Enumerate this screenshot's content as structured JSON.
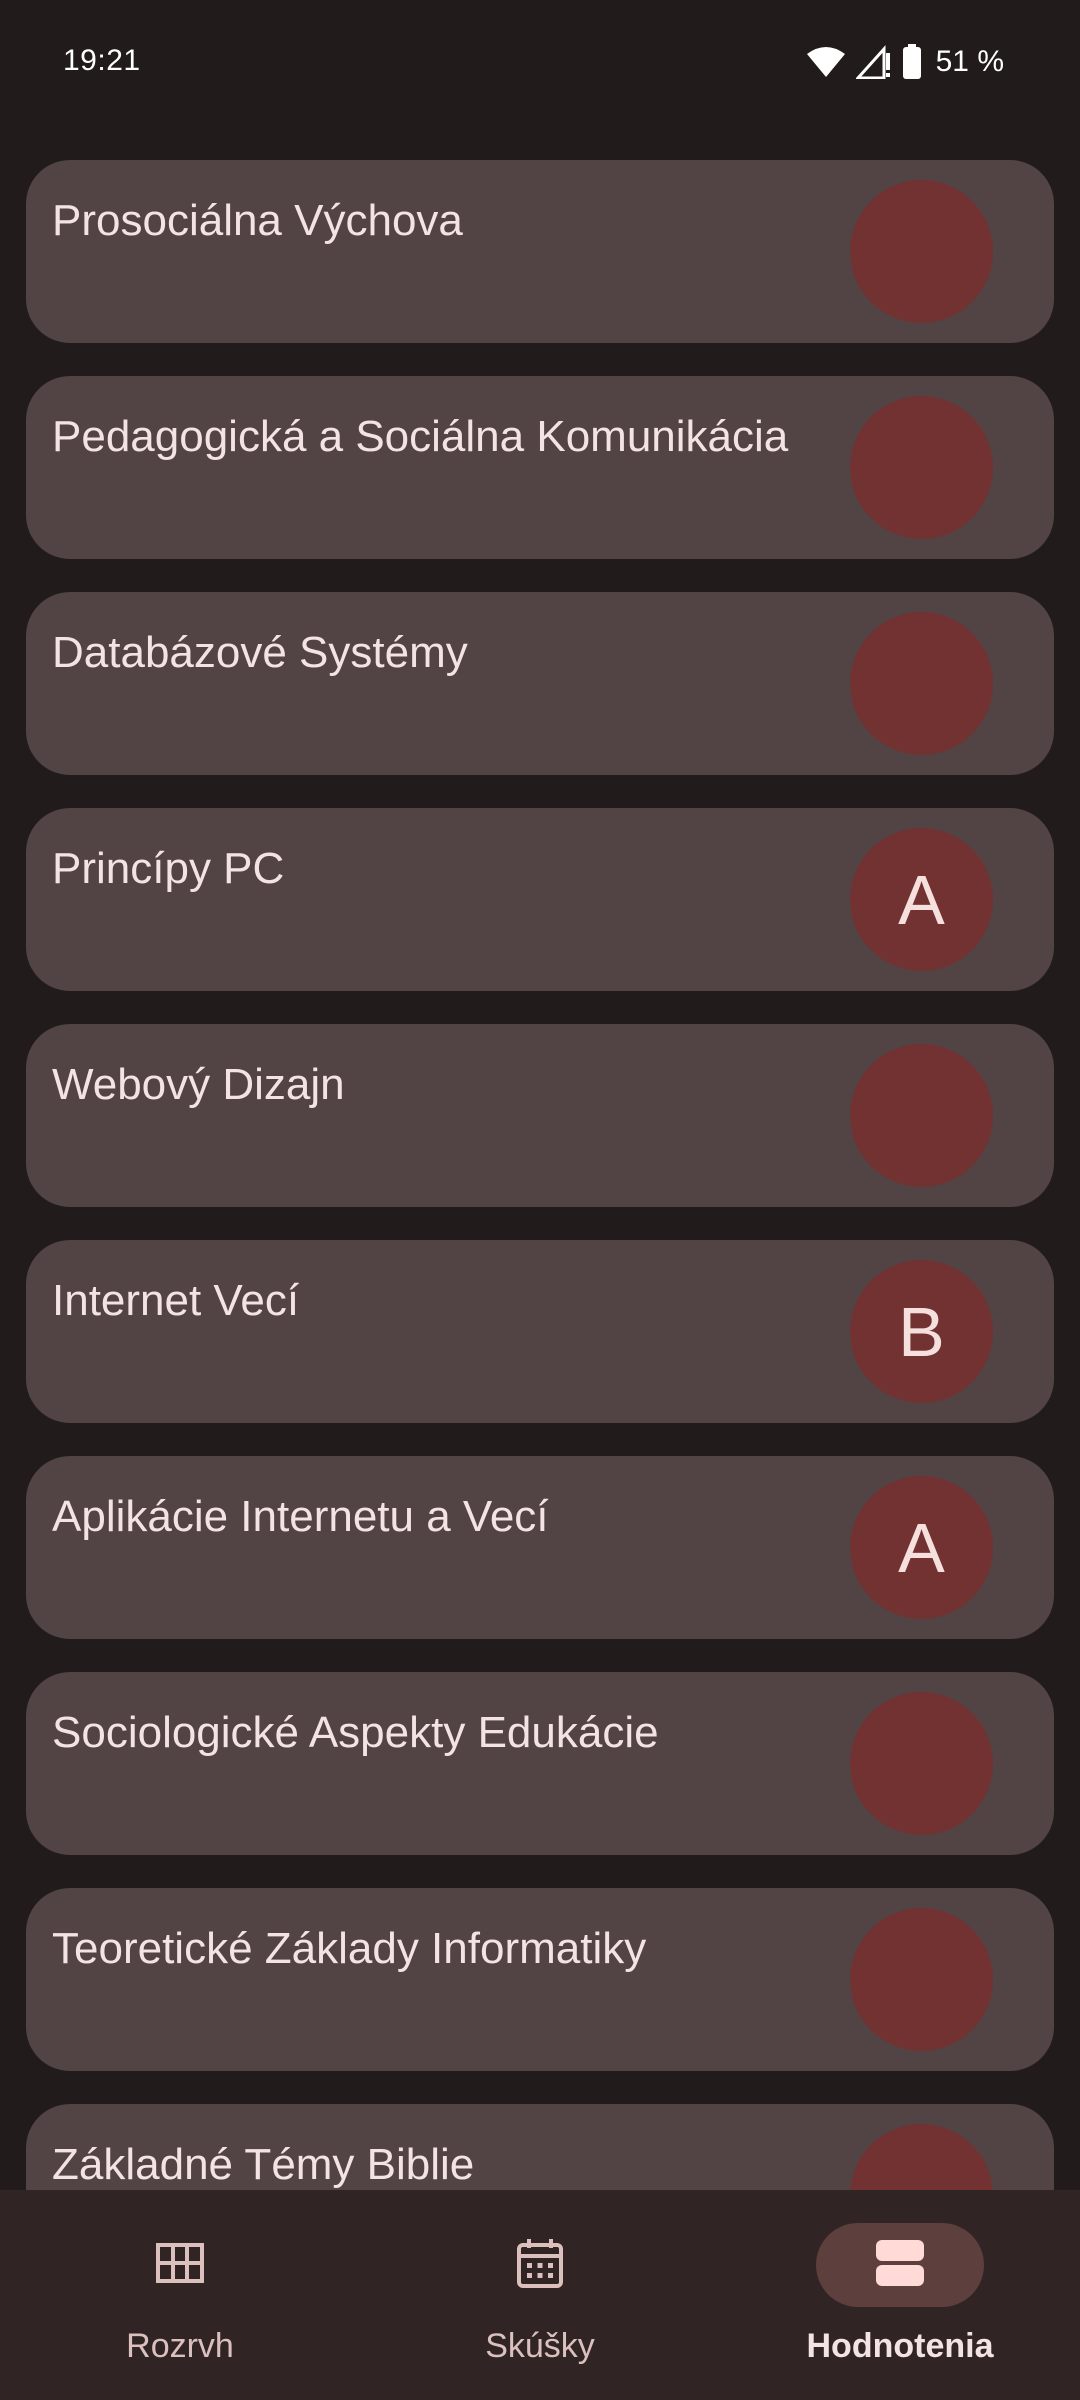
{
  "status_bar": {
    "time": "19:21",
    "battery_percent": "51 %"
  },
  "colors": {
    "background": "#211c1b",
    "card": "#524344",
    "grade_circle": "#733232",
    "nav_bar": "#302524",
    "nav_active_pill": "#5d3f3d"
  },
  "subjects": [
    {
      "name": "Prosociálna Výchova",
      "grade": ""
    },
    {
      "name": "Pedagogická a Sociálna Komunikácia",
      "grade": ""
    },
    {
      "name": "Databázové Systémy",
      "grade": ""
    },
    {
      "name": "Princípy PC",
      "grade": "A"
    },
    {
      "name": "Webový Dizajn",
      "grade": ""
    },
    {
      "name": "Internet Vecí",
      "grade": "B"
    },
    {
      "name": "Aplikácie Internetu a Vecí",
      "grade": "A"
    },
    {
      "name": "Sociologické Aspekty Edukácie",
      "grade": ""
    },
    {
      "name": "Teoretické Základy Informatiky",
      "grade": ""
    },
    {
      "name": "Základné Témy Biblie",
      "grade": ""
    }
  ],
  "bottom_nav": {
    "items": [
      {
        "label": "Rozrvh",
        "icon": "grid-icon",
        "active": false
      },
      {
        "label": "Skúšky",
        "icon": "calendar-icon",
        "active": false
      },
      {
        "label": "Hodnotenia",
        "icon": "view-agenda-icon",
        "active": true
      }
    ]
  }
}
